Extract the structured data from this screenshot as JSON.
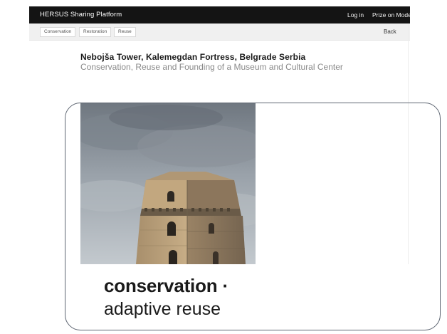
{
  "topbar": {
    "brand": "HERSUS Sharing Platform",
    "login": "Log in",
    "prize": "Prize on Mode"
  },
  "subbar": {
    "tags": [
      "Conservation",
      "Restoration",
      "Reuse"
    ],
    "back": "Back"
  },
  "heritage": {
    "title": "Nebojša Tower, Kalemegdan Fortress, Belgrade Serbia",
    "subtitle": "Conservation, Reuse and Founding of a Museum and Cultural Center"
  },
  "caption": {
    "line1": "conservation ·",
    "line2": "adaptive reuse"
  }
}
